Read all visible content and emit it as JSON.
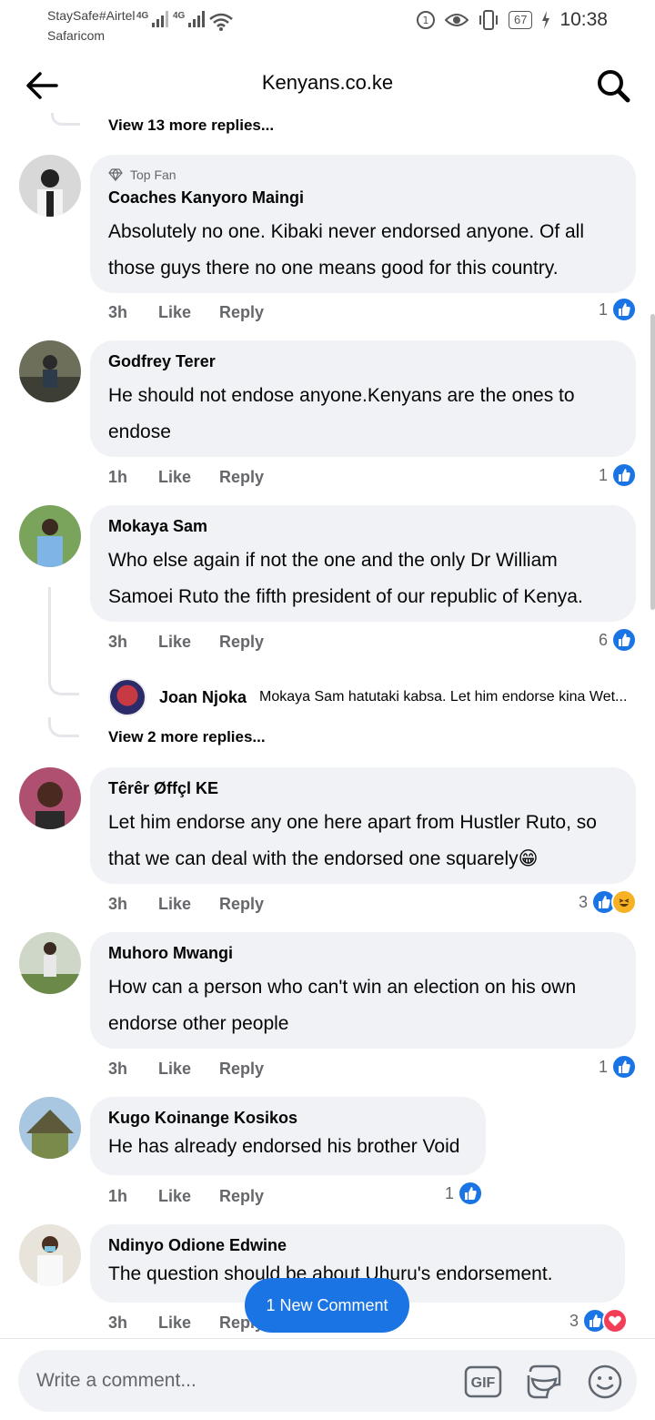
{
  "status_bar": {
    "carrier_1": "StaySafe#Airtel",
    "carrier_2": "Safaricom",
    "net_1": "4G",
    "net_2": "4G",
    "battery": "67",
    "time": "10:38"
  },
  "header": {
    "title": "Kenyans.co.ke"
  },
  "view_more_top": "View 13 more replies...",
  "comments": [
    {
      "badge": "Top Fan",
      "author": "Coaches Kanyoro Maingi",
      "lines": [
        "Absolutely no one. Kibaki never endorsed anyone. Of all",
        "those guys there no one means good for this country."
      ],
      "time": "3h",
      "like": "Like",
      "reply": "Reply",
      "reactions": "1"
    },
    {
      "author": "Godfrey Terer",
      "lines": [
        "He should not endose anyone.Kenyans are the ones to",
        "endose"
      ],
      "time": "1h",
      "like": "Like",
      "reply": "Reply",
      "reactions": "1"
    },
    {
      "author": "Mokaya Sam",
      "lines": [
        "Who else again if not the one and the only Dr William",
        "Samoei Ruto the fifth president of our republic of Kenya."
      ],
      "time": "3h",
      "like": "Like",
      "reply": "Reply",
      "reactions": "6"
    },
    {
      "author": "Têrêr Øffçl KE",
      "lines": [
        "Let him endorse any one here apart from Hustler Ruto, so",
        "that we can deal with the endorsed one squarely😁"
      ],
      "time": "3h",
      "like": "Like",
      "reply": "Reply",
      "reactions": "3"
    },
    {
      "author": "Muhoro Mwangi",
      "lines": [
        "How can a person who can't win an election on his own",
        "endorse other people"
      ],
      "time": "3h",
      "like": "Like",
      "reply": "Reply",
      "reactions": "1"
    },
    {
      "author": "Kugo Koinange Kosikos",
      "lines": [
        "He has already endorsed his brother Void"
      ],
      "time": "1h",
      "like": "Like",
      "reply": "Reply",
      "reactions": "1"
    },
    {
      "author": "Ndinyo Odione Edwine",
      "lines": [
        "The question should be about Uhuru's endorsement."
      ],
      "time": "3h",
      "like": "Like",
      "reply": "Reply",
      "reactions": "3"
    }
  ],
  "reply_preview": {
    "author": "Joan Njoka",
    "text": "Mokaya Sam hatutaki kabsa. Let him endorse kina Wet..."
  },
  "view_more_mid": "View 2 more replies...",
  "new_comment_pill": "1 New Comment",
  "composer": {
    "placeholder": "Write a comment...",
    "gif_label": "GIF"
  },
  "colors": {
    "accent": "#1b74e4",
    "bubble": "#f0f2f5",
    "muted_text": "#65676b"
  }
}
